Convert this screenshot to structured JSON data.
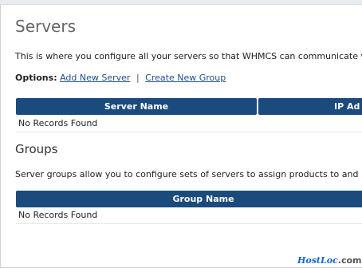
{
  "servers": {
    "title": "Servers",
    "description": "This is where you configure all your servers so that WHMCS can communicate with",
    "options_label": "Options:",
    "add_server_link": "Add New Server",
    "separator": "|",
    "create_group_link": "Create New Group",
    "table": {
      "columns": [
        "Server Name",
        "IP Ad"
      ],
      "empty_text": "No Records Found"
    }
  },
  "groups": {
    "title": "Groups",
    "description": "Server groups allow you to configure sets of servers to assign products to and hav",
    "table": {
      "columns": [
        "Group Name"
      ],
      "empty_text": "No Records Found"
    }
  },
  "watermark": {
    "part1": "HostLoc",
    "part2": ".com"
  },
  "colors": {
    "table_header": "#1a4b7c",
    "link": "#1d4f8b"
  }
}
